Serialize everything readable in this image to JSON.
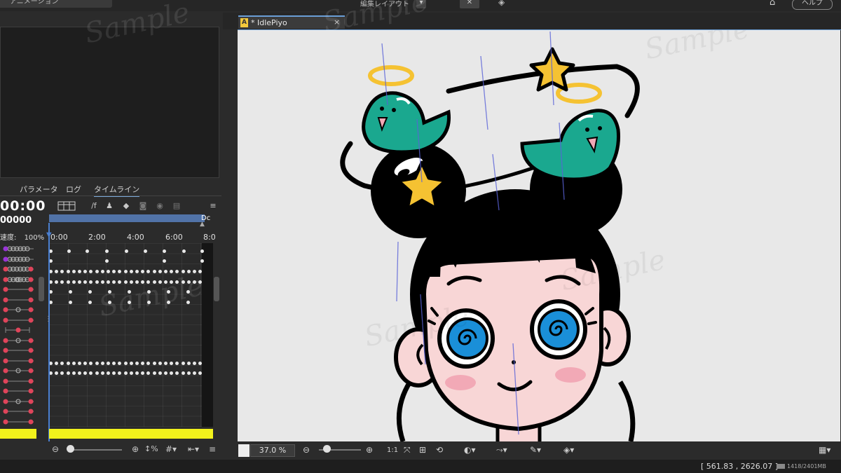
{
  "app": {
    "menu_left_label": "アニメーション",
    "menu_mid_label": "編集レイアウト",
    "help_label": "ヘルプ"
  },
  "document": {
    "tab_label": "* IdlePiyo",
    "tab_close": "×",
    "tab_icon": "A"
  },
  "left_panel": {
    "tabs": [
      "パラメータ",
      "ログ",
      "タイムライン"
    ],
    "active_tab": "タイムライン",
    "time_display": "00:00",
    "frame_display": "00000",
    "speed_label": "速度:",
    "speed_value": "100%",
    "fps_icon": "/f",
    "ruler_ticks": [
      "0:00",
      "2:00",
      "4:00",
      "6:00",
      "8:0"
    ],
    "end_marker": "Dc",
    "layer_rows": 18
  },
  "canvas": {
    "zoom_value": "37.0",
    "zoom_unit": "%",
    "ratio_label": "1:1",
    "background_color": "#e8e8e8"
  },
  "status": {
    "coordinates": "[ 561.83 , 2626.07 ]",
    "memory": "1418/2401MB"
  },
  "watermark_text": "Sample",
  "colors": {
    "accent": "#6a9ed6",
    "playhead": "#4a7fd0",
    "work_area": "#f2f21c",
    "keyframe_red": "#e0445a",
    "keyframe_purple": "#9a35d8",
    "bird_teal": "#1aa88f",
    "star_yellow": "#f5c232",
    "eye_blue": "#1a8fd8",
    "skin": "#f8d6d6"
  }
}
